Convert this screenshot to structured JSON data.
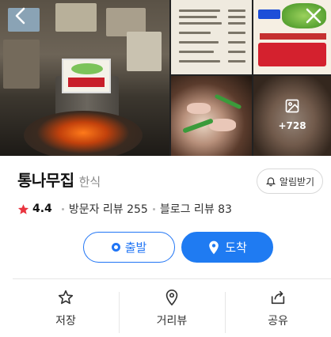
{
  "gallery": {
    "more_count": "+728",
    "icons": {
      "back": "chevron-left-icon",
      "close": "close-icon",
      "photos": "image-icon"
    }
  },
  "place": {
    "name": "통나무집",
    "category": "한식",
    "notify_label": "알림받기",
    "rating": "4.4",
    "visitor_reviews": "방문자 리뷰 255",
    "blog_reviews": "블로그 리뷰 83"
  },
  "route": {
    "depart_label": "출발",
    "arrive_label": "도착"
  },
  "actions": [
    {
      "label": "저장",
      "icon": "star-outline-icon"
    },
    {
      "label": "거리뷰",
      "icon": "location-pin-icon"
    },
    {
      "label": "공유",
      "icon": "share-icon"
    }
  ],
  "colors": {
    "accent_blue": "#1f7bf2",
    "star_red": "#e9343f",
    "muted_text": "#8a8a8a"
  }
}
